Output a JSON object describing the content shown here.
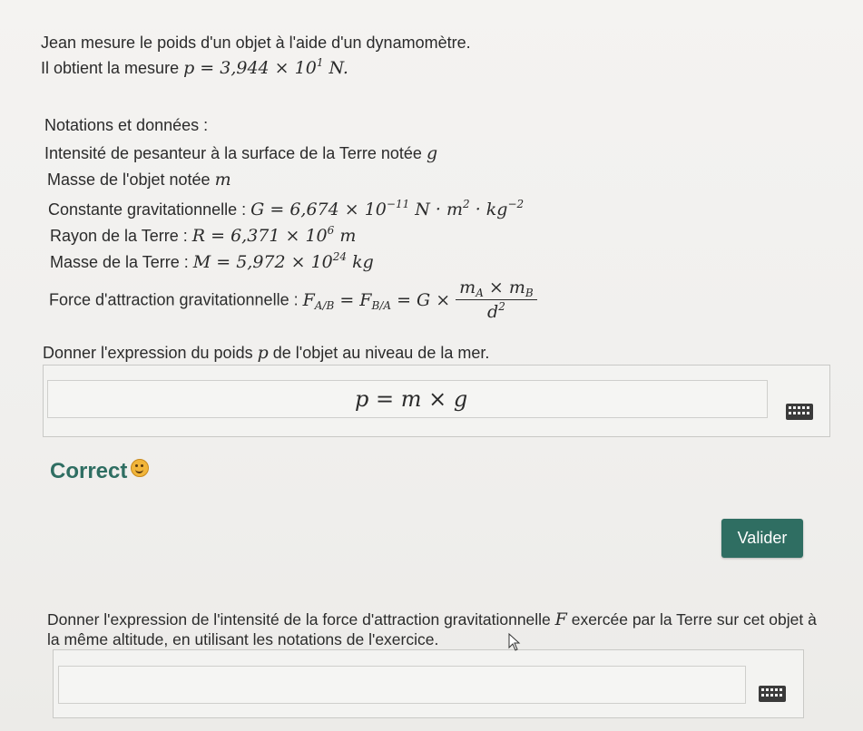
{
  "intro": {
    "line1": "Jean mesure le poids d'un objet à l'aide d'un dynamomètre.",
    "line2_text": "Il obtient la mesure ",
    "line2_math": "p = 3,944 × 10",
    "line2_exp": "1",
    "line2_unit": " N."
  },
  "notations": {
    "heading": "Notations et données :",
    "gravity_text": "Intensité de pesanteur à la surface de la Terre notée ",
    "gravity_symbol": "g",
    "mass_text": "Masse de l'objet notée ",
    "mass_symbol": "m",
    "G_text": "Constante gravitationnelle : ",
    "G_math": "G = 6,674 × 10",
    "G_exp": "−11",
    "G_unit": " N · m",
    "G_unit_exp1": "2",
    "G_unit2": " · kg",
    "G_unit_exp2": "−2",
    "R_text": "Rayon de la Terre : ",
    "R_math": "R = 6,371 × 10",
    "R_exp": "6",
    "R_unit": " m",
    "M_text": "Masse de la Terre : ",
    "M_math": "M = 5,972 × 10",
    "M_exp": "24",
    "M_unit": " kg",
    "F_text": "Force d'attraction gravitationnelle : ",
    "F_lhs": "F",
    "F_sub1": "A/B",
    "F_eq": " = F",
    "F_sub2": "B/A",
    "F_eq2": " = G ×",
    "F_num": "m",
    "F_num_sub1": "A",
    "F_num_times": " × m",
    "F_num_sub2": "B",
    "F_den": "d",
    "F_den_exp": "2"
  },
  "question1": {
    "prompt_text": "Donner l'expression du poids ",
    "prompt_symbol": "p",
    "prompt_text2": " de l'objet au niveau de la mer.",
    "answer": "p = m × g",
    "feedback": "Correct",
    "submit_label": "Valider"
  },
  "question2": {
    "prompt_line1_a": "Donner l'expression de l'intensité de la force d'attraction gravitationnelle ",
    "prompt_symbol": "F",
    "prompt_line1_b": " exercée par la Terre sur cet objet à",
    "prompt_line2": "la même altitude, en utilisant les notations de l'exercice.",
    "answer": ""
  },
  "icons": {
    "keyboard": "keyboard-icon",
    "smiley": "smiley-icon",
    "cursor": "mouse-cursor-icon"
  },
  "colors": {
    "accent": "#2f6e62",
    "smiley": "#f1b53a"
  }
}
